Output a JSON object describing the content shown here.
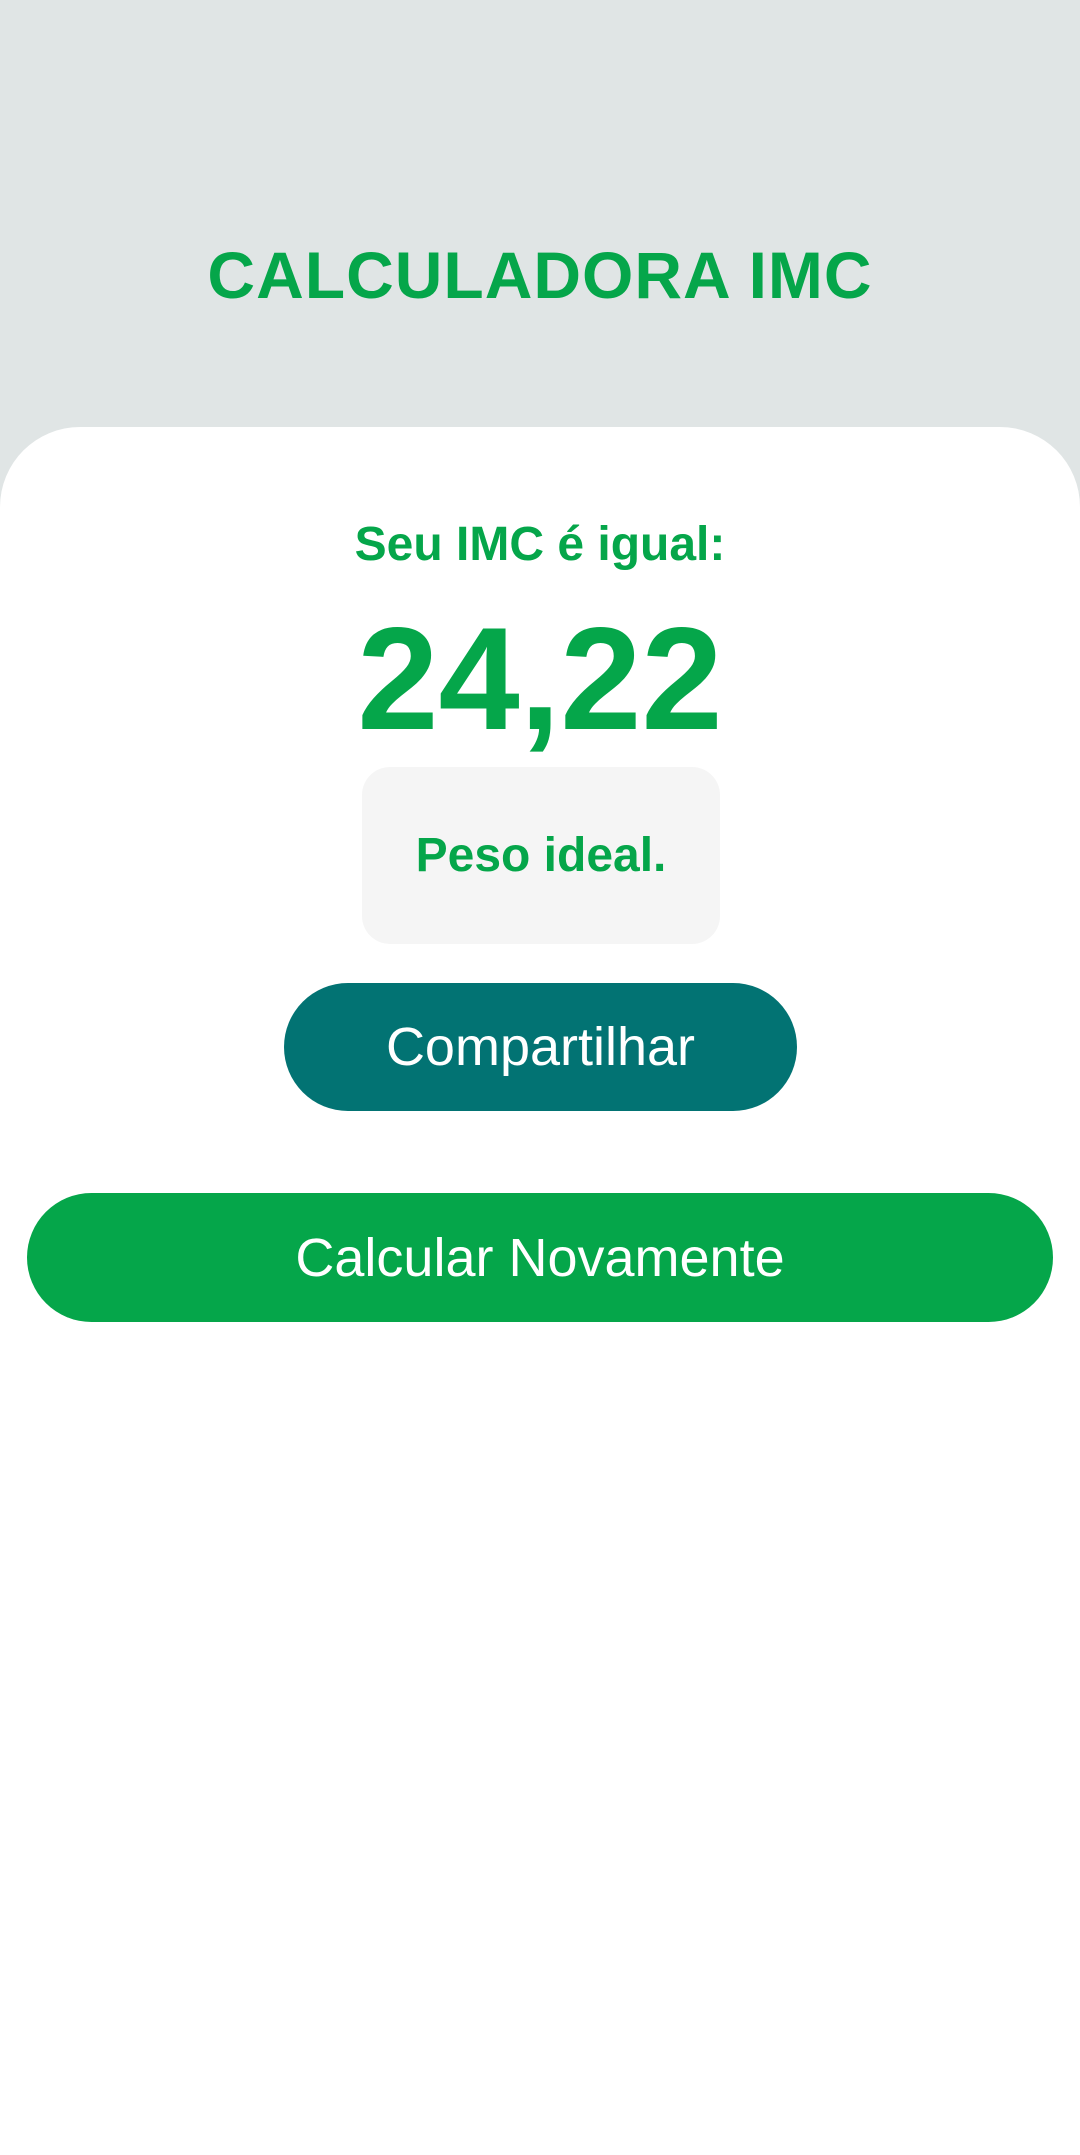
{
  "header": {
    "title": "CALCULADORA IMC"
  },
  "result": {
    "label": "Seu IMC é igual:",
    "value": "24,22",
    "classification": "Peso ideal."
  },
  "actions": {
    "share_label": "Compartilhar",
    "recalculate_label": "Calcular Novamente"
  },
  "colors": {
    "brand_green": "#05a64a",
    "share_teal": "#027373",
    "header_background": "#e0e5e5",
    "card_background": "#ffffff",
    "classification_background": "#f5f5f5"
  }
}
